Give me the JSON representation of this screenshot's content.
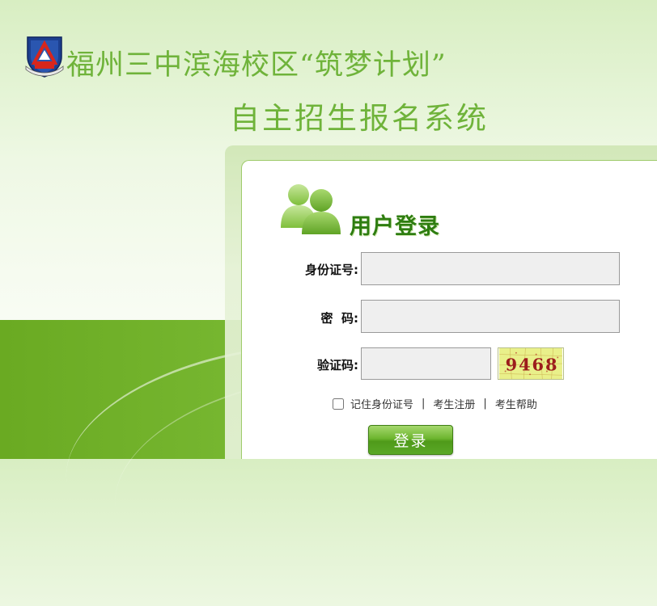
{
  "header": {
    "title_line1": "福州三中滨海校区“筑梦计划”",
    "title_line2": "自主招生报名系统"
  },
  "login": {
    "heading": "用户登录",
    "id_label": "身份证号:",
    "id_value": "",
    "password_label": "密  码:",
    "password_value": "",
    "captcha_label": "验证码:",
    "captcha_value": "",
    "captcha_image_text": "9468",
    "remember_label": "记住身份证号",
    "remember_checked": false,
    "separator": "|",
    "register_link": "考生注册",
    "help_link": "考生帮助",
    "submit_label": "登录"
  },
  "colors": {
    "title_green": "#6fb33a",
    "heading_green": "#2e7d10",
    "band_green": "#6aaa22",
    "button_green": "#5aa826"
  },
  "icons": {
    "logo": "school-shield-logo",
    "users": "users-icon"
  }
}
